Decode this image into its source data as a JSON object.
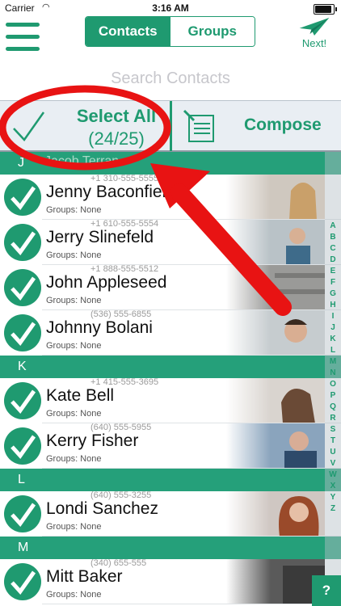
{
  "status": {
    "carrier": "Carrier",
    "time": "3:16 AM"
  },
  "nav": {
    "tabs": [
      {
        "label": "Contacts"
      },
      {
        "label": "Groups"
      }
    ],
    "next_label": "Next!"
  },
  "search": {
    "placeholder": "Search Contacts"
  },
  "actions": {
    "select_all": "Select All",
    "count": "(24/25)",
    "compose": "Compose"
  },
  "sections": [
    {
      "letter": "J",
      "ghost": "Jacob Terran"
    },
    {
      "letter": "K"
    },
    {
      "letter": "L"
    },
    {
      "letter": "M"
    }
  ],
  "contacts": [
    {
      "name": "Jenny Baconfields",
      "phone": "+1 310-555-5555",
      "groups": "Groups: None"
    },
    {
      "name": "Jerry Slinefeld",
      "phone": "+1 610-555-5554",
      "groups": "Groups: None"
    },
    {
      "name": "John Appleseed",
      "phone": "+1 888-555-5512",
      "groups": "Groups: None"
    },
    {
      "name": "Johnny Bolani",
      "phone": "(536) 555-6855",
      "groups": "Groups: None"
    },
    {
      "name": "Kate Bell",
      "phone": "+1 415-555-3695",
      "groups": "Groups: None"
    },
    {
      "name": "Kerry Fisher",
      "phone": "(640) 555-5955",
      "groups": "Groups: None"
    },
    {
      "name": "Londi Sanchez",
      "phone": "(640) 555-3255",
      "groups": "Groups: None"
    },
    {
      "name": "Mitt Baker",
      "phone": "(340) 655-555",
      "groups": "Groups: None"
    }
  ],
  "index_letters": [
    "A",
    "B",
    "C",
    "D",
    "E",
    "F",
    "G",
    "H",
    "I",
    "J",
    "K",
    "L",
    "M",
    "N",
    "O",
    "P",
    "Q",
    "R",
    "S",
    "T",
    "U",
    "V",
    "W",
    "X",
    "Y",
    "Z"
  ],
  "help_label": "?",
  "colors": {
    "accent": "#1f9a70",
    "section": "#25a07a",
    "annotation": "#e81313"
  }
}
